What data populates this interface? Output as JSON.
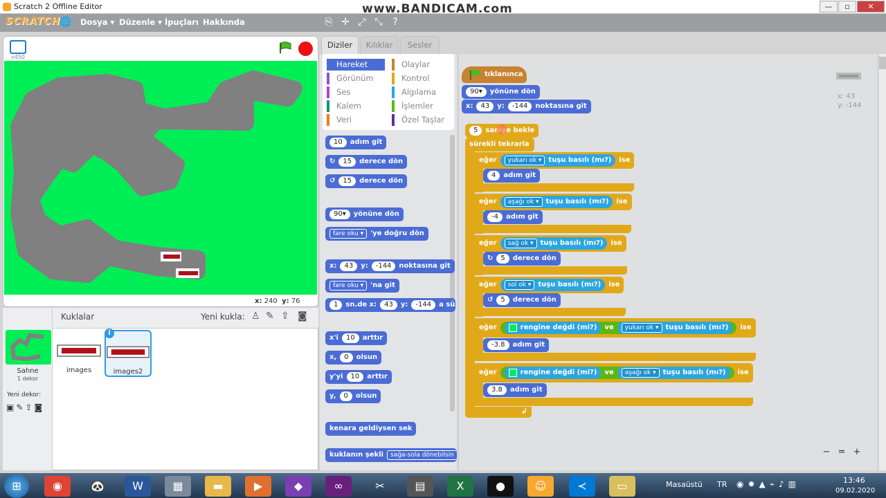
{
  "window": {
    "title": "Scratch 2 Offline Editor",
    "watermark": "www.BANDICAM.com",
    "btn_min": "—",
    "btn_max": "▫",
    "btn_close": "✕"
  },
  "menubar": {
    "logo": "SCRATCH",
    "menus": [
      "Dosya ▾",
      "Düzenle ▾",
      "İpuçları",
      "Hakkında"
    ]
  },
  "stage": {
    "version": "v450",
    "x_label": "x:",
    "x_value": "240",
    "y_label": "y:",
    "y_value": "76"
  },
  "sprites": {
    "header": "Kuklalar",
    "new_sprite_label": "Yeni kukla:",
    "stage_label": "Sahne",
    "stage_sub": "1 dekor",
    "new_backdrop_label": "Yeni dekor:",
    "items": [
      "images",
      "images2"
    ]
  },
  "tabs": [
    "Diziler",
    "Kılıklar",
    "Sesler"
  ],
  "categories_left": [
    "Hareket",
    "Görünüm",
    "Ses",
    "Kalem",
    "Veri"
  ],
  "categories_right": [
    "Olaylar",
    "Kontrol",
    "Algılama",
    "İşlemler",
    "Özel Taşlar"
  ],
  "colors": {
    "hareket": "#4a6cd4",
    "gorunum": "#8a55d7",
    "ses": "#bb42c3",
    "kalem": "#0e9a6c",
    "veri": "#ee7d16",
    "olaylar": "#c88330",
    "kontrol": "#e1a91a",
    "algilama": "#2ca5e2",
    "islemler": "#5cb712",
    "ozel": "#632d99"
  },
  "palette": {
    "move": {
      "num": "10",
      "label": "adım git"
    },
    "turn_right": {
      "num": "15",
      "label": "derece dön"
    },
    "turn_left": {
      "num": "15",
      "label": "derece dön"
    },
    "point_dir": {
      "num": "90▾",
      "label": "yönüne dön"
    },
    "point_to": {
      "dd": "fare oku ▾",
      "label": "'ye doğru dön"
    },
    "goto_xy": {
      "x": "x:",
      "xv": "43",
      "y": "y:",
      "yv": "-144",
      "label": "noktasına git"
    },
    "goto": {
      "dd": "fare oku ▾",
      "label": "'na git"
    },
    "glide": {
      "num": "1",
      "a": "sn.de x:",
      "xv": "43",
      "y": "y:",
      "yv": "-144",
      "label": "a süzü"
    },
    "change_x": {
      "label": "x'i",
      "num": "10",
      "label2": "arttır"
    },
    "set_x": {
      "label": "x,",
      "num": "0",
      "label2": "olsun"
    },
    "change_y": {
      "label": "y'yi",
      "num": "10",
      "label2": "arttır"
    },
    "set_y": {
      "label": "y,",
      "num": "0",
      "label2": "olsun"
    },
    "bounce": {
      "label": "kenara geldiysen sek"
    },
    "rotation": {
      "label": "kuklanın şekli",
      "dd": "sağa-sola dönebilsin"
    }
  },
  "script": {
    "hat": "tıklanınca",
    "dir": {
      "num": "90▾",
      "label": "yönüne dön"
    },
    "goto": {
      "x": "x:",
      "xv": "43",
      "y": "y:",
      "yv": "-144",
      "label": "noktasına git"
    },
    "wait": {
      "num": "5",
      "label": "saniye bekle"
    },
    "forever": "sürekli tekrarla",
    "if_word": "eğer",
    "ise": "ise",
    "ve": "ve",
    "key_pressed": "tuşu basılı (mı?)",
    "touch_color": "rengine değdi (mi?)",
    "keys": [
      "yukarı ok ▾",
      "aşağı ok ▾",
      "sağ ok ▾",
      "sol ok ▾",
      "yukarı ok ▾",
      "aşağı ok ▾"
    ],
    "bodies": [
      {
        "num": "4",
        "label": "adım git"
      },
      {
        "num": "-4",
        "label": "adım git"
      },
      {
        "num": "5",
        "label": "derece dön"
      },
      {
        "num": "5",
        "label": "derece dön"
      },
      {
        "num": "-3.8",
        "label": "adım git"
      },
      {
        "num": "3.8",
        "label": "adım git"
      }
    ],
    "loop_arrow": "↲"
  },
  "workspace_info": {
    "x": "x: 43",
    "y": "y: -144"
  },
  "zoom": [
    "−",
    "=",
    "+"
  ],
  "taskbar": {
    "desktop": "Masaüstü",
    "lang": "TR",
    "time": "13:46",
    "date": "09.02.2020"
  }
}
